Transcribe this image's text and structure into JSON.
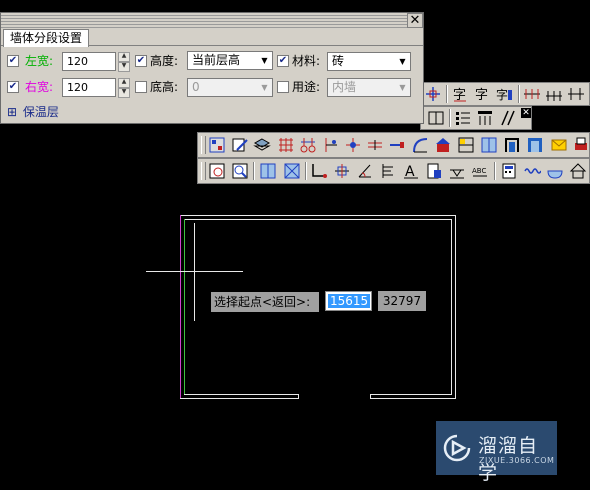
{
  "panel": {
    "title_tab": "墙体分段设置",
    "close_glyph": "✕",
    "row1": {
      "left_width_checked": true,
      "left_width_label": "左宽:",
      "left_width_value": "120",
      "height_checked": true,
      "height_label": "高度:",
      "height_value": "当前层高",
      "material_checked": true,
      "material_label": "材料:",
      "material_value": "砖"
    },
    "row2": {
      "right_width_checked": true,
      "right_width_label": "右宽:",
      "right_width_value": "120",
      "base_height_checked": false,
      "base_height_label": "底高:",
      "base_height_value": "0",
      "usage_checked": false,
      "usage_label": "用途:",
      "usage_value": "内墙"
    },
    "insulation": {
      "expand_glyph": "⊞",
      "label": "保温层"
    }
  },
  "colors": {
    "left_width_label": "#00b000",
    "right_width_label": "#e000e0",
    "wall": "#e8e8e8",
    "selection": "#3399ff",
    "logo_bg": "#2b4a6f"
  },
  "command_line": {
    "prompt": "选择起点<返回>:",
    "x_value": "15615",
    "y_value": "32797"
  },
  "watermark": {
    "name": "溜溜自学",
    "url": "ZIXUE.3066.COM"
  },
  "toolbar_icons": {
    "row_a": [
      "snap-icon",
      "text-style-icon",
      "text-icon",
      "text-edit-icon",
      "dimension-icon",
      "dimension-chain-icon",
      "dimension-baseline-icon"
    ],
    "row_b": [
      "door-icon",
      "list-icon",
      "table-icon",
      "hatch-icon"
    ],
    "row_c": [
      "axis-grid-icon",
      "edit-icon",
      "layer-icon",
      "grid-icon",
      "column-icon",
      "offset-icon",
      "node-icon",
      "wall-icon",
      "wall-break-icon",
      "arc-icon",
      "roof-icon",
      "window-icon",
      "door-window-icon",
      "stair-icon",
      "mail-icon",
      "print-icon"
    ],
    "row_d": [
      "frame-icon",
      "zoom-icon",
      "layout-icon",
      "dim-box-icon",
      "polyline-icon",
      "align-icon",
      "angle-icon",
      "elevation-icon",
      "text-a-icon",
      "paste-icon",
      "level-icon",
      "abc-icon",
      "calc-icon",
      "wave-icon",
      "sink-icon",
      "house-icon"
    ]
  }
}
